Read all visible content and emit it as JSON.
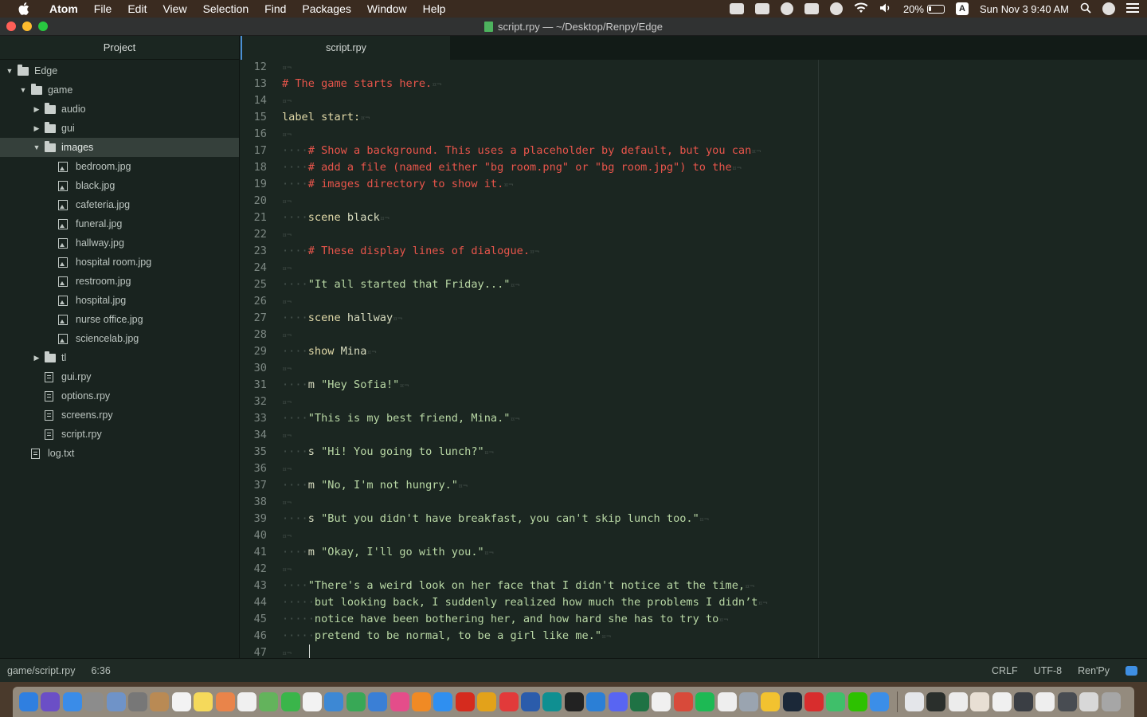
{
  "menubar": {
    "app_name": "Atom",
    "items": [
      "File",
      "Edit",
      "View",
      "Selection",
      "Find",
      "Packages",
      "Window",
      "Help"
    ],
    "battery_percent": "20%",
    "battery_level": 0.2,
    "input_letter": "A",
    "clock": "Sun Nov 3  9:40 AM"
  },
  "window": {
    "title": "script.rpy — ~/Desktop/Renpy/Edge"
  },
  "tree": {
    "header": "Project",
    "rows": [
      {
        "label": "Edge",
        "type": "folder",
        "depth": 0,
        "expanded": true
      },
      {
        "label": "game",
        "type": "folder",
        "depth": 1,
        "expanded": true
      },
      {
        "label": "audio",
        "type": "folder",
        "depth": 2,
        "expanded": false
      },
      {
        "label": "gui",
        "type": "folder",
        "depth": 2,
        "expanded": false
      },
      {
        "label": "images",
        "type": "folder",
        "depth": 2,
        "expanded": true,
        "selected": true
      },
      {
        "label": "bedroom.jpg",
        "type": "image",
        "depth": 3
      },
      {
        "label": "black.jpg",
        "type": "image",
        "depth": 3
      },
      {
        "label": "cafeteria.jpg",
        "type": "image",
        "depth": 3
      },
      {
        "label": "funeral.jpg",
        "type": "image",
        "depth": 3
      },
      {
        "label": "hallway.jpg",
        "type": "image",
        "depth": 3
      },
      {
        "label": "hospital room.jpg",
        "type": "image",
        "depth": 3
      },
      {
        "label": "restroom.jpg",
        "type": "image",
        "depth": 3
      },
      {
        "label": "hospital.jpg",
        "type": "image",
        "depth": 3
      },
      {
        "label": "nurse office.jpg",
        "type": "image",
        "depth": 3
      },
      {
        "label": "sciencelab.jpg",
        "type": "image",
        "depth": 3
      },
      {
        "label": "tl",
        "type": "folder",
        "depth": 2,
        "expanded": false
      },
      {
        "label": "gui.rpy",
        "type": "file",
        "depth": 2
      },
      {
        "label": "options.rpy",
        "type": "file",
        "depth": 2
      },
      {
        "label": "screens.rpy",
        "type": "file",
        "depth": 2
      },
      {
        "label": "script.rpy",
        "type": "file",
        "depth": 2
      },
      {
        "label": "log.txt",
        "type": "file",
        "depth": 1
      }
    ]
  },
  "editor": {
    "tab_label": "script.rpy",
    "lines": [
      {
        "n": "12",
        "indent": "",
        "tokens": []
      },
      {
        "n": "13",
        "indent": "",
        "tokens": [
          {
            "t": "# The game starts here.",
            "c": "comment"
          }
        ]
      },
      {
        "n": "14",
        "indent": "",
        "tokens": []
      },
      {
        "n": "15",
        "indent": "",
        "tokens": [
          {
            "t": "label start:",
            "c": "keyword"
          }
        ]
      },
      {
        "n": "16",
        "indent": "",
        "tokens": []
      },
      {
        "n": "17",
        "indent": "····",
        "tokens": [
          {
            "t": "# Show a background. This uses a placeholder by default, but you can",
            "c": "comment"
          }
        ]
      },
      {
        "n": "18",
        "indent": "····",
        "tokens": [
          {
            "t": "# add a file (named either \"bg room.png\" or \"bg room.jpg\") to the",
            "c": "comment"
          }
        ]
      },
      {
        "n": "19",
        "indent": "····",
        "tokens": [
          {
            "t": "# images directory to show it.",
            "c": "comment"
          }
        ]
      },
      {
        "n": "20",
        "indent": "",
        "tokens": []
      },
      {
        "n": "21",
        "indent": "····",
        "tokens": [
          {
            "t": "scene",
            "c": "keyword"
          },
          {
            "t": " black",
            "c": "plain"
          }
        ]
      },
      {
        "n": "22",
        "indent": "",
        "tokens": []
      },
      {
        "n": "23",
        "indent": "····",
        "tokens": [
          {
            "t": "# These display lines of dialogue.",
            "c": "comment"
          }
        ]
      },
      {
        "n": "24",
        "indent": "",
        "tokens": []
      },
      {
        "n": "25",
        "indent": "····",
        "tokens": [
          {
            "t": "\"It all started that Friday...\"",
            "c": "string"
          }
        ]
      },
      {
        "n": "26",
        "indent": "",
        "tokens": []
      },
      {
        "n": "27",
        "indent": "····",
        "tokens": [
          {
            "t": "scene",
            "c": "keyword"
          },
          {
            "t": " hallway",
            "c": "plain"
          }
        ]
      },
      {
        "n": "28",
        "indent": "",
        "tokens": []
      },
      {
        "n": "29",
        "indent": "····",
        "tokens": [
          {
            "t": "show",
            "c": "keyword"
          },
          {
            "t": " Mina",
            "c": "plain"
          }
        ]
      },
      {
        "n": "30",
        "indent": "",
        "tokens": []
      },
      {
        "n": "31",
        "indent": "····",
        "tokens": [
          {
            "t": "m ",
            "c": "plain"
          },
          {
            "t": "\"Hey Sofia!\"",
            "c": "string"
          }
        ]
      },
      {
        "n": "32",
        "indent": "",
        "tokens": []
      },
      {
        "n": "33",
        "indent": "····",
        "tokens": [
          {
            "t": "\"This is my best friend, Mina.\"",
            "c": "string"
          }
        ]
      },
      {
        "n": "34",
        "indent": "",
        "tokens": []
      },
      {
        "n": "35",
        "indent": "····",
        "tokens": [
          {
            "t": "s ",
            "c": "plain"
          },
          {
            "t": "\"Hi! You going to lunch?\"",
            "c": "string"
          }
        ]
      },
      {
        "n": "36",
        "indent": "",
        "tokens": []
      },
      {
        "n": "37",
        "indent": "····",
        "tokens": [
          {
            "t": "m ",
            "c": "plain"
          },
          {
            "t": "\"No, I'm not hungry.\"",
            "c": "string"
          }
        ]
      },
      {
        "n": "38",
        "indent": "",
        "tokens": []
      },
      {
        "n": "39",
        "indent": "····",
        "tokens": [
          {
            "t": "s ",
            "c": "plain"
          },
          {
            "t": "\"But you didn't have breakfast, you can't skip lunch too.\"",
            "c": "string"
          }
        ]
      },
      {
        "n": "40",
        "indent": "",
        "tokens": []
      },
      {
        "n": "41",
        "indent": "····",
        "tokens": [
          {
            "t": "m ",
            "c": "plain"
          },
          {
            "t": "\"Okay, I'll go with you.\"",
            "c": "string"
          }
        ]
      },
      {
        "n": "42",
        "indent": "",
        "tokens": []
      },
      {
        "n": "43",
        "indent": "····",
        "tokens": [
          {
            "t": "\"There's a weird look on her face that I didn't notice at the time,",
            "c": "string"
          }
        ]
      },
      {
        "n": "44",
        "indent": "·····",
        "tokens": [
          {
            "t": "but looking back, I suddenly realized how much the problems I didn’t",
            "c": "string"
          }
        ]
      },
      {
        "n": "45",
        "indent": "·····",
        "tokens": [
          {
            "t": "notice have been bothering her, and how hard she has to try to",
            "c": "string"
          }
        ]
      },
      {
        "n": "46",
        "indent": "·····",
        "tokens": [
          {
            "t": "pretend to be normal, to be a girl like me.\"",
            "c": "string"
          }
        ]
      },
      {
        "n": "47",
        "indent": "",
        "tokens": []
      }
    ],
    "eol_marker": "¤¬"
  },
  "statusbar": {
    "file_path": "game/script.rpy",
    "cursor_position": "6:36",
    "line_ending": "CRLF",
    "encoding": "UTF-8",
    "grammar": "Ren'Py"
  },
  "dock": {
    "apps": [
      {
        "name": "finder-icon",
        "color": "#2f7fe0"
      },
      {
        "name": "siri-icon",
        "color": "#6b4fc6"
      },
      {
        "name": "safari-icon",
        "color": "#3a8ce8"
      },
      {
        "name": "launchpad-icon",
        "color": "#8c8c8c"
      },
      {
        "name": "preview-icon",
        "color": "#6f93c8"
      },
      {
        "name": "system-preferences-icon",
        "color": "#777777"
      },
      {
        "name": "contacts-icon",
        "color": "#b98a54"
      },
      {
        "name": "calendar-icon",
        "color": "#f3f3f3"
      },
      {
        "name": "notes-icon",
        "color": "#f5d95b"
      },
      {
        "name": "photos-icon",
        "color": "#e9844a"
      },
      {
        "name": "reminders-icon",
        "color": "#f0f0f0"
      },
      {
        "name": "maps-icon",
        "color": "#63b35c"
      },
      {
        "name": "facetime-icon",
        "color": "#3ab54a"
      },
      {
        "name": "textedit-icon",
        "color": "#f2f2f2"
      },
      {
        "name": "onedrive-icon",
        "color": "#3d88d4"
      },
      {
        "name": "numbers-icon",
        "color": "#38a856"
      },
      {
        "name": "keynote-icon",
        "color": "#3a7fd6"
      },
      {
        "name": "itunes-icon",
        "color": "#e44d8a"
      },
      {
        "name": "books-icon",
        "color": "#f08a24"
      },
      {
        "name": "app-store-icon",
        "color": "#2f8ff0"
      },
      {
        "name": "acrobat-icon",
        "color": "#d52b1e"
      },
      {
        "name": "chrome-icon",
        "color": "#e3a21a"
      },
      {
        "name": "netease-music-icon",
        "color": "#e23a3a"
      },
      {
        "name": "word-icon",
        "color": "#2b5cab"
      },
      {
        "name": "arduino-icon",
        "color": "#0f8f91"
      },
      {
        "name": "terminal-icon",
        "color": "#222222"
      },
      {
        "name": "sourcetree-icon",
        "color": "#2b7fd6"
      },
      {
        "name": "discord-icon",
        "color": "#5865f2"
      },
      {
        "name": "excel-icon",
        "color": "#1f7244"
      },
      {
        "name": "pages-icon",
        "color": "#f0f0f0"
      },
      {
        "name": "game-icon",
        "color": "#d84a3a"
      },
      {
        "name": "spotify-icon",
        "color": "#1db954"
      },
      {
        "name": "typora-icon",
        "color": "#eeeeee"
      },
      {
        "name": "screenshot-icon",
        "color": "#9aa4b0"
      },
      {
        "name": "mindnode-icon",
        "color": "#f2c230"
      },
      {
        "name": "steam-icon",
        "color": "#1b2838"
      },
      {
        "name": "bookmark-icon",
        "color": "#d82d2d"
      },
      {
        "name": "robinhood-icon",
        "color": "#3fbf6a"
      },
      {
        "name": "wechat-icon",
        "color": "#2dc100"
      },
      {
        "name": "atom-icon",
        "color": "#3b8ee8"
      }
    ],
    "docs": [
      {
        "name": "document-thumbnail-icon",
        "color": "#e4e6ea"
      },
      {
        "name": "terminal-window-thumbnail-icon",
        "color": "#2a2f2c"
      },
      {
        "name": "document-thumbnail-icon",
        "color": "#ececec"
      },
      {
        "name": "document-thumbnail-icon",
        "color": "#e8dfd4"
      },
      {
        "name": "document-thumbnail-icon",
        "color": "#f0f0f0"
      },
      {
        "name": "window-thumbnail-icon",
        "color": "#3a3e44"
      },
      {
        "name": "document-thumbnail-icon",
        "color": "#eeeeee"
      },
      {
        "name": "window-thumbnail-icon",
        "color": "#484c52"
      },
      {
        "name": "window-thumbnail-icon",
        "color": "#d8d8d8"
      },
      {
        "name": "trash-icon",
        "color": "#a6a6a6"
      }
    ]
  }
}
